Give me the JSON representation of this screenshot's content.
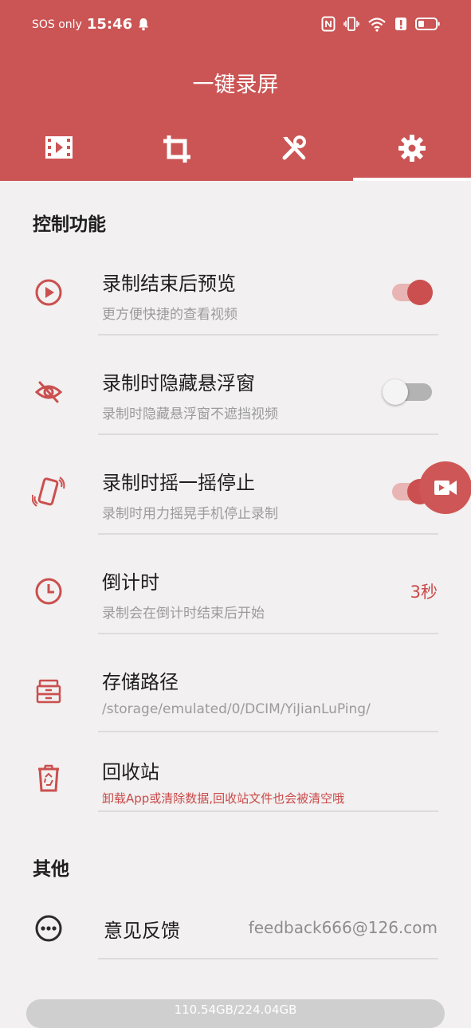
{
  "status_bar": {
    "carrier": "SOS only",
    "time": "15:46"
  },
  "header": {
    "title": "一键录屏"
  },
  "tabs": [
    {
      "icon": "video-icon",
      "active": false
    },
    {
      "icon": "crop-icon",
      "active": false
    },
    {
      "icon": "tools-icon",
      "active": false
    },
    {
      "icon": "gear-icon",
      "active": true
    }
  ],
  "sections": {
    "control": "控制功能",
    "other": "其他"
  },
  "settings": {
    "preview": {
      "title": "录制结束后预览",
      "subtitle": "更方便快捷的查看视频",
      "enabled": true,
      "icon": "play-circle-icon"
    },
    "hide_float": {
      "title": "录制时隐藏悬浮窗",
      "subtitle": "录制时隐藏悬浮窗不遮挡视频",
      "enabled": false,
      "icon": "eye-off-icon"
    },
    "shake_stop": {
      "title": "录制时摇一摇停止",
      "subtitle": "录制时用力摇晃手机停止录制",
      "enabled": true,
      "icon": "phone-shake-icon"
    },
    "countdown": {
      "title": "倒计时",
      "subtitle": "录制会在倒计时结束后开始",
      "value": "3秒",
      "icon": "clock-icon"
    },
    "storage_path": {
      "title": "存储路径",
      "subtitle": "/storage/emulated/0/DCIM/YiJianLuPing/",
      "icon": "drawer-icon"
    },
    "recycle": {
      "title": "回收站",
      "subtitle": "卸载App或清除数据,回收站文件也会被清空哦",
      "icon": "recycle-bin-icon"
    },
    "feedback": {
      "title": "意见反馈",
      "value": "feedback666@126.com",
      "icon": "more-circle-icon"
    }
  },
  "storage": {
    "text": "110.54GB/224.04GB",
    "used_fraction": 0.493
  },
  "colors": {
    "accent": "#cb5454",
    "background": "#f2f0f0"
  }
}
